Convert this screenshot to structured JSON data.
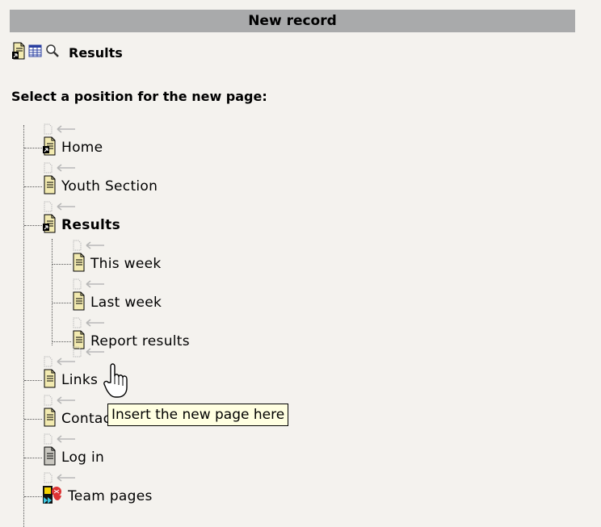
{
  "header": {
    "title": "New record"
  },
  "record": {
    "title": "Results"
  },
  "instruction": "Select a position for the new page:",
  "tree": {
    "nodes": [
      {
        "label": "Home",
        "icon": "shortcut-page-icon",
        "bold": false
      },
      {
        "label": "Youth Section",
        "icon": "page-icon",
        "bold": false
      },
      {
        "label": "Results",
        "icon": "shortcut-page-icon",
        "bold": true
      },
      {
        "label": "This week",
        "icon": "page-icon",
        "bold": false
      },
      {
        "label": "Last week",
        "icon": "page-icon",
        "bold": false
      },
      {
        "label": "Report results",
        "icon": "page-icon",
        "bold": false
      },
      {
        "label": "Links",
        "icon": "page-icon",
        "bold": false
      },
      {
        "label": "Contact",
        "icon": "page-icon",
        "bold": false
      },
      {
        "label": "Log in",
        "icon": "login-page-icon",
        "bold": false
      },
      {
        "label": "Team pages",
        "icon": "mountpoint-page-icon",
        "bold": false
      }
    ]
  },
  "tooltip": "Insert the new page here",
  "colors": {
    "header_bg": "#a9aaab",
    "page_bg": "#f4f2ee",
    "tooltip_bg": "#ffffe1",
    "page_icon_fill": "#f2eab0"
  }
}
